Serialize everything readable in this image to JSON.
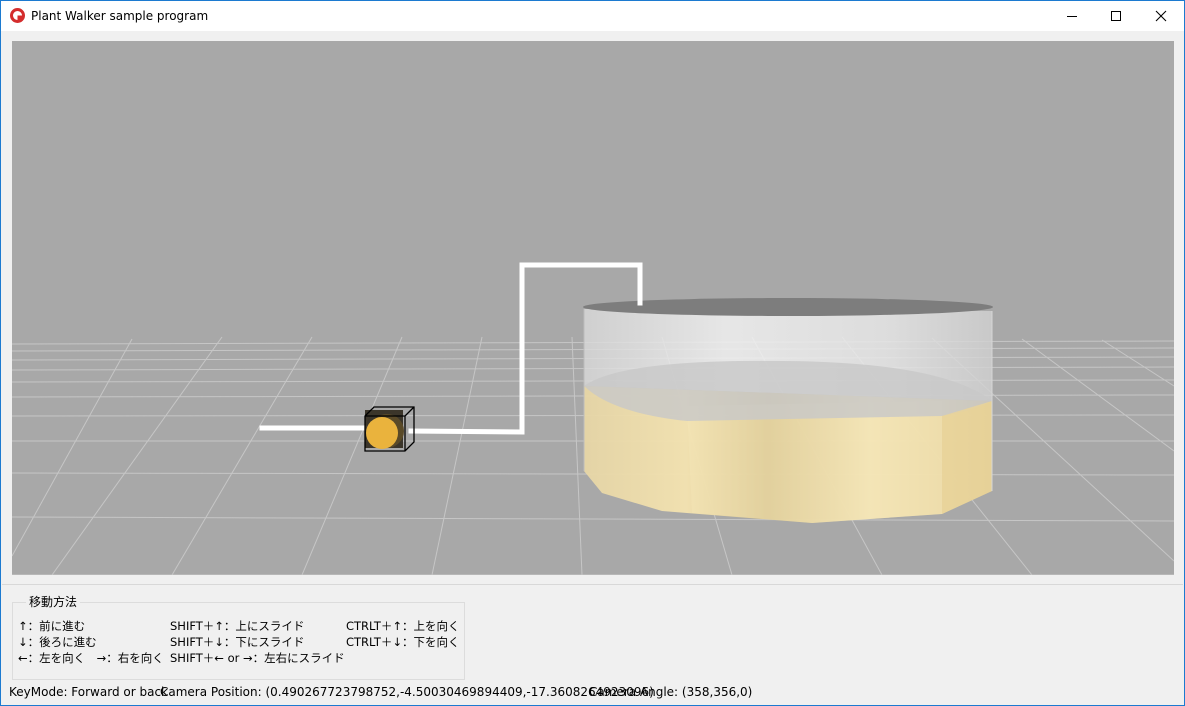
{
  "window": {
    "title": "Plant Walker sample program",
    "icon": "app-icon"
  },
  "colors": {
    "viewport_background": "#a8a8a8",
    "grid_line": "#c8c8c8",
    "pipe": "#ffffff",
    "tank_liquid": "#f2dfa1",
    "tank_body": "#ebebeb",
    "walker_ball": "#eab33d"
  },
  "movement": {
    "title": "移動方法",
    "forward": "↑：前に進む",
    "backward": "↓：後ろに進む",
    "turn": "←：左を向く　→：右を向く",
    "slide_up": "SHIFT＋↑：上にスライド",
    "slide_down": "SHIFT＋↓：下にスライド",
    "slide_side": "SHIFT＋← or →：左右にスライド",
    "look_up": "CTRLT＋↑：上を向く",
    "look_down": "CTRLT＋↓：下を向く"
  },
  "status": {
    "keymode": "KeyMode: Forward or back",
    "camera_position": "Camera Position: (0.490267723798752,-4.50030469894409,-17.3608264923096)",
    "camera_angle": "Camera Angle: (358,356,0)"
  }
}
